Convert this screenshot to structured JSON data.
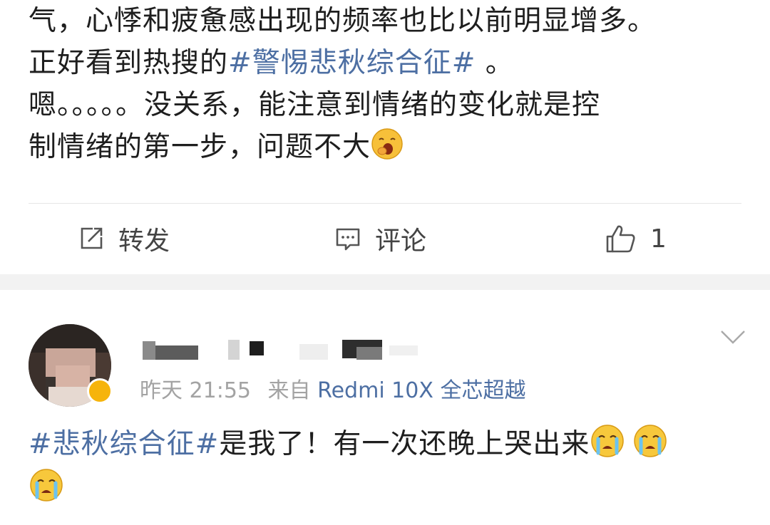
{
  "post": {
    "line1": "气，心悸和疲惫感出现的频率也比以前明显增多。",
    "line2_prefix": "正好看到热搜的",
    "line2_hashtag": "#警惕悲秋综合征#",
    "line2_suffix": " 。",
    "line3": "嗯。。。。。没关系，能注意到情绪的变化就是控",
    "line4": "制情绪的第一步，问题不大",
    "line4_emoji": "yawn-emoji"
  },
  "actions": {
    "repost_label": "转发",
    "repost_icon": "repost-icon",
    "comment_label": "评论",
    "comment_icon": "comment-icon",
    "like_count": "1",
    "like_icon": "thumbs-up-icon"
  },
  "comment": {
    "time": "昨天 21:55",
    "from_prefix": "来自",
    "source": "Redmi 10X 全芯超越",
    "body_hashtag": "#悲秋综合征#",
    "body_text": "是我了！有一次还晚上哭出来",
    "emojis": [
      "crying-emoji",
      "crying-emoji",
      "crying-emoji"
    ]
  },
  "colors": {
    "link": "#4d6fa3",
    "meta": "#a3a3a3",
    "separator": "#f2f2f2",
    "verified": "#f6b40c"
  }
}
